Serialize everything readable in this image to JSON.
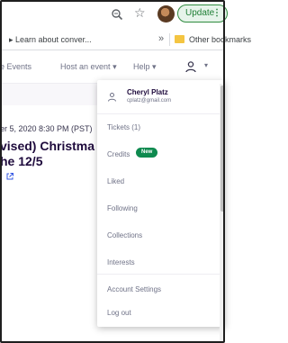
{
  "browser": {
    "update_label": "Update",
    "update_menu_glyph": "⋮",
    "zoom_icon": "zoom-icon",
    "star_glyph": "☆",
    "bookmarks": {
      "item1": "▸ Learn about conver...",
      "overflow": "»",
      "other": "Other bookmarks"
    }
  },
  "site_nav": {
    "events": "e Events",
    "host": "Host an event",
    "help": "Help",
    "host_chev": "▾",
    "help_chev": "▾",
    "user_chev": "▾"
  },
  "event": {
    "date": "er 5, 2020 8:30 PM (PST)",
    "title_line1": "vised) Christma",
    "title_line2": "he 12/5"
  },
  "account_menu": {
    "name": "Cheryl Platz",
    "email": "cplatz@gmail.com",
    "items": {
      "tickets": "Tickets (1)",
      "credits": "Credits",
      "credits_badge": "New",
      "liked": "Liked",
      "following": "Following",
      "collections": "Collections",
      "interests": "Interests",
      "account_settings": "Account Settings",
      "logout": "Log out"
    }
  },
  "colors": {
    "update_green": "#1e7e34",
    "badge_green": "#0e8a4f",
    "title": "#1e0a3c",
    "muted_text": "#6f7287"
  }
}
